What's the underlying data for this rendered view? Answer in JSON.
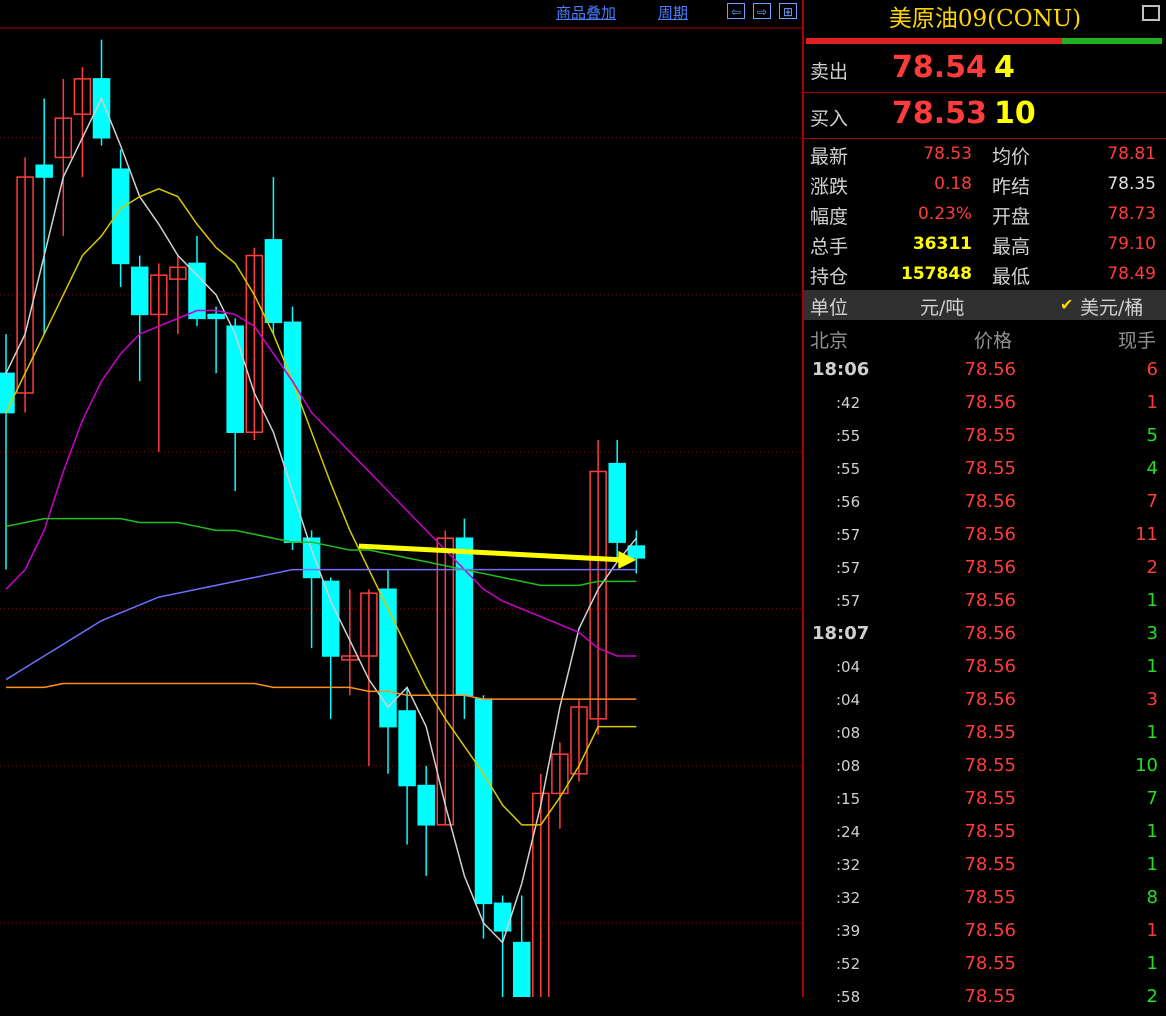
{
  "toolbar": {
    "overlay": "商品叠加",
    "period": "周期",
    "nav_left": "⇦",
    "nav_right": "⇨",
    "nav_box": "⊞"
  },
  "panel": {
    "title": "美原油09(CONU)",
    "ask": {
      "label": "卖出",
      "price": "78.54",
      "vol": "4"
    },
    "bid": {
      "label": "买入",
      "price": "78.53",
      "vol": "10"
    },
    "quote": [
      {
        "l1": "最新",
        "v1": "78.53",
        "c1": "#ff3c3c",
        "l2": "均价",
        "v2": "78.81",
        "c2": "#ff3c3c"
      },
      {
        "l1": "涨跌",
        "v1": "0.18",
        "c1": "#ff3c3c",
        "l2": "昨结",
        "v2": "78.35",
        "c2": "#e0e0e0"
      },
      {
        "l1": "幅度",
        "v1": "0.23%",
        "c1": "#ff3c3c",
        "l2": "开盘",
        "v2": "78.73",
        "c2": "#ff3c3c"
      },
      {
        "l1": "总手",
        "v1": "36311",
        "c1": "#ffff00",
        "l2": "最高",
        "v2": "79.10",
        "c2": "#ff3c3c"
      },
      {
        "l1": "持仓",
        "v1": "157848",
        "c1": "#ffff00",
        "l2": "最低",
        "v2": "78.49",
        "c2": "#ff3c3c"
      }
    ],
    "unit": {
      "label": "单位",
      "opt1": "元/吨",
      "check": "✔",
      "opt2": "美元/桶"
    },
    "ticks_header": {
      "time": "北京",
      "price": "价格",
      "vol": "现手"
    },
    "ticks": [
      {
        "t": "18:06",
        "p": "78.56",
        "v": "6",
        "vc": "#ff3c3c",
        "bold": true
      },
      {
        "t": ":42",
        "p": "78.56",
        "v": "1",
        "vc": "#ff3c3c"
      },
      {
        "t": ":55",
        "p": "78.55",
        "v": "5",
        "vc": "#20e020"
      },
      {
        "t": ":55",
        "p": "78.55",
        "v": "4",
        "vc": "#20e020"
      },
      {
        "t": ":56",
        "p": "78.56",
        "v": "7",
        "vc": "#ff3c3c"
      },
      {
        "t": ":57",
        "p": "78.56",
        "v": "11",
        "vc": "#ff3c3c"
      },
      {
        "t": ":57",
        "p": "78.56",
        "v": "2",
        "vc": "#ff3c3c"
      },
      {
        "t": ":57",
        "p": "78.56",
        "v": "1",
        "vc": "#20e020"
      },
      {
        "t": "18:07",
        "p": "78.56",
        "v": "3",
        "vc": "#20e020",
        "bold": true
      },
      {
        "t": ":04",
        "p": "78.56",
        "v": "1",
        "vc": "#20e020"
      },
      {
        "t": ":04",
        "p": "78.56",
        "v": "3",
        "vc": "#ff3c3c"
      },
      {
        "t": ":08",
        "p": "78.55",
        "v": "1",
        "vc": "#20e020"
      },
      {
        "t": ":08",
        "p": "78.55",
        "v": "10",
        "vc": "#20e020"
      },
      {
        "t": ":15",
        "p": "78.55",
        "v": "7",
        "vc": "#20e020"
      },
      {
        "t": ":24",
        "p": "78.55",
        "v": "1",
        "vc": "#20e020"
      },
      {
        "t": ":32",
        "p": "78.55",
        "v": "1",
        "vc": "#20e020"
      },
      {
        "t": ":32",
        "p": "78.55",
        "v": "8",
        "vc": "#20e020"
      },
      {
        "t": ":39",
        "p": "78.56",
        "v": "1",
        "vc": "#ff3c3c"
      },
      {
        "t": ":52",
        "p": "78.55",
        "v": "1",
        "vc": "#20e020"
      },
      {
        "t": ":58",
        "p": "78.55",
        "v": "2",
        "vc": "#20e020"
      }
    ]
  },
  "chart_data": {
    "type": "candlestick",
    "colors": {
      "up": "#ff3c3c",
      "down": "#00ffff",
      "grid": "#8b0000",
      "arrow": "#ffff00"
    },
    "candles": [
      {
        "o": 79.0,
        "c": 78.9,
        "h": 79.1,
        "l": 78.5
      },
      {
        "o": 78.95,
        "c": 79.5,
        "h": 79.55,
        "l": 78.9
      },
      {
        "o": 79.53,
        "c": 79.5,
        "h": 79.7,
        "l": 79.1
      },
      {
        "o": 79.55,
        "c": 79.65,
        "h": 79.75,
        "l": 79.35
      },
      {
        "o": 79.66,
        "c": 79.75,
        "h": 79.78,
        "l": 79.5
      },
      {
        "o": 79.75,
        "c": 79.6,
        "h": 79.85,
        "l": 79.58
      },
      {
        "o": 79.52,
        "c": 79.28,
        "h": 79.57,
        "l": 79.22
      },
      {
        "o": 79.27,
        "c": 79.15,
        "h": 79.3,
        "l": 78.98
      },
      {
        "o": 79.15,
        "c": 79.25,
        "h": 79.28,
        "l": 78.8
      },
      {
        "o": 79.24,
        "c": 79.27,
        "h": 79.3,
        "l": 79.1
      },
      {
        "o": 79.28,
        "c": 79.14,
        "h": 79.35,
        "l": 79.12
      },
      {
        "o": 79.15,
        "c": 79.14,
        "h": 79.17,
        "l": 79.0
      },
      {
        "o": 79.12,
        "c": 78.85,
        "h": 79.14,
        "l": 78.7
      },
      {
        "o": 78.85,
        "c": 79.3,
        "h": 79.32,
        "l": 78.83
      },
      {
        "o": 79.34,
        "c": 79.13,
        "h": 79.5,
        "l": 79.1
      },
      {
        "o": 79.13,
        "c": 78.57,
        "h": 79.17,
        "l": 78.55
      },
      {
        "o": 78.58,
        "c": 78.48,
        "h": 78.6,
        "l": 78.3
      },
      {
        "o": 78.47,
        "c": 78.28,
        "h": 78.48,
        "l": 78.12
      },
      {
        "o": 78.27,
        "c": 78.28,
        "h": 78.45,
        "l": 78.18
      },
      {
        "o": 78.28,
        "c": 78.44,
        "h": 78.45,
        "l": 78.0
      },
      {
        "o": 78.45,
        "c": 78.1,
        "h": 78.5,
        "l": 77.98
      },
      {
        "o": 78.14,
        "c": 77.95,
        "h": 78.2,
        "l": 77.8
      },
      {
        "o": 77.95,
        "c": 77.85,
        "h": 78.0,
        "l": 77.72
      },
      {
        "o": 77.85,
        "c": 78.58,
        "h": 78.6,
        "l": 77.85
      },
      {
        "o": 78.58,
        "c": 78.18,
        "h": 78.63,
        "l": 78.12
      },
      {
        "o": 78.17,
        "c": 77.65,
        "h": 78.18,
        "l": 77.56
      },
      {
        "o": 77.65,
        "c": 77.58,
        "h": 77.67,
        "l": 77.37
      },
      {
        "o": 77.55,
        "c": 77.38,
        "h": 77.67,
        "l": 77.18
      },
      {
        "o": 77.36,
        "c": 77.93,
        "h": 77.98,
        "l": 77.33
      },
      {
        "o": 77.93,
        "c": 78.03,
        "h": 78.06,
        "l": 77.84
      },
      {
        "o": 77.98,
        "c": 78.15,
        "h": 78.17,
        "l": 77.96
      },
      {
        "o": 78.12,
        "c": 78.75,
        "h": 78.83,
        "l": 78.08
      },
      {
        "o": 78.77,
        "c": 78.57,
        "h": 78.83,
        "l": 78.52
      },
      {
        "o": 78.56,
        "c": 78.53,
        "h": 78.6,
        "l": 78.49
      }
    ],
    "ma_lines": [
      {
        "color": "#d0d0d0",
        "values": [
          79.0,
          79.1,
          79.3,
          79.5,
          79.6,
          79.7,
          79.58,
          79.45,
          79.38,
          79.3,
          79.25,
          79.2,
          79.1,
          78.95,
          78.85,
          78.7,
          78.55,
          78.42,
          78.32,
          78.22,
          78.15,
          78.2,
          78.1,
          77.9,
          77.72,
          77.6,
          77.55,
          77.7,
          77.9,
          78.15,
          78.35,
          78.45,
          78.52,
          78.58
        ]
      },
      {
        "color": "#d8c800",
        "values": [
          78.9,
          79.0,
          79.1,
          79.2,
          79.3,
          79.35,
          79.42,
          79.45,
          79.47,
          79.45,
          79.38,
          79.32,
          79.28,
          79.2,
          79.1,
          78.98,
          78.85,
          78.72,
          78.6,
          78.5,
          78.4,
          78.3,
          78.2,
          78.12,
          78.05,
          77.98,
          77.9,
          77.85,
          77.85,
          77.92,
          78.0,
          78.1,
          78.1,
          78.1
        ]
      },
      {
        "color": "#cc00cc",
        "values": [
          78.45,
          78.5,
          78.6,
          78.75,
          78.88,
          78.98,
          79.05,
          79.1,
          79.12,
          79.14,
          79.16,
          79.16,
          79.15,
          79.12,
          79.05,
          78.98,
          78.9,
          78.85,
          78.8,
          78.75,
          78.7,
          78.65,
          78.6,
          78.55,
          78.5,
          78.45,
          78.42,
          78.4,
          78.38,
          78.36,
          78.34,
          78.3,
          78.28,
          78.28
        ]
      },
      {
        "color": "#20c020",
        "values": [
          78.61,
          78.62,
          78.63,
          78.63,
          78.63,
          78.63,
          78.63,
          78.62,
          78.62,
          78.62,
          78.61,
          78.6,
          78.6,
          78.59,
          78.58,
          78.57,
          78.57,
          78.56,
          78.55,
          78.55,
          78.54,
          78.53,
          78.52,
          78.51,
          78.5,
          78.49,
          78.48,
          78.47,
          78.46,
          78.46,
          78.46,
          78.47,
          78.47,
          78.47
        ]
      },
      {
        "color": "#7070ff",
        "values": [
          78.22,
          78.25,
          78.28,
          78.31,
          78.34,
          78.37,
          78.39,
          78.41,
          78.43,
          78.44,
          78.45,
          78.46,
          78.47,
          78.48,
          78.49,
          78.5,
          78.5,
          78.5,
          78.5,
          78.5,
          78.5,
          78.5,
          78.5,
          78.5,
          78.5,
          78.5,
          78.5,
          78.5,
          78.5,
          78.5,
          78.5,
          78.5,
          78.5,
          78.5
        ]
      },
      {
        "color": "#ff9020",
        "values": [
          78.2,
          78.2,
          78.2,
          78.21,
          78.21,
          78.21,
          78.21,
          78.21,
          78.21,
          78.21,
          78.21,
          78.21,
          78.21,
          78.21,
          78.2,
          78.2,
          78.2,
          78.2,
          78.2,
          78.19,
          78.19,
          78.18,
          78.18,
          78.18,
          78.18,
          78.17,
          78.17,
          78.17,
          78.17,
          78.17,
          78.17,
          78.17,
          78.17,
          78.17
        ]
      }
    ],
    "arrow": {
      "from": {
        "i": 19,
        "p": 78.56
      },
      "to": {
        "i": 33,
        "p": 78.53
      }
    }
  }
}
